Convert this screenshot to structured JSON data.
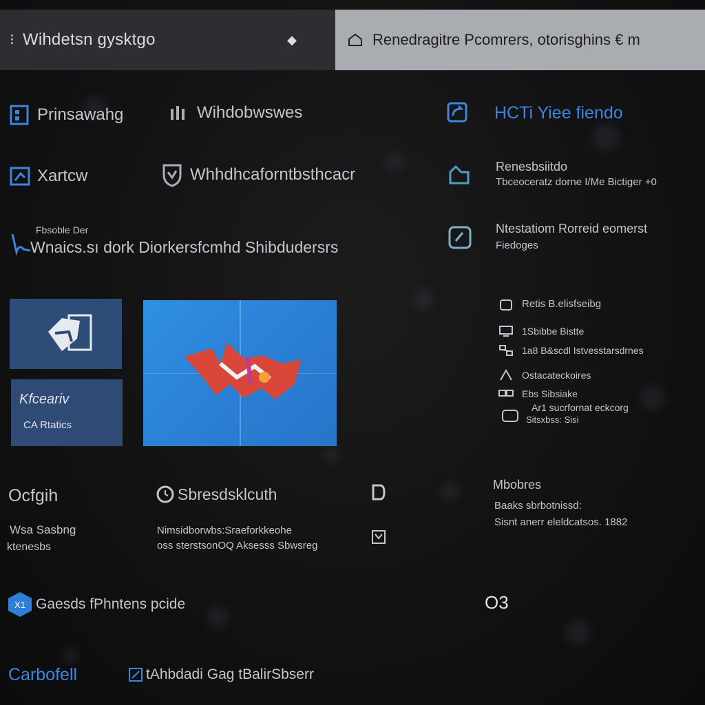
{
  "titlebar": {
    "title": "Wihdetsn gysktgo",
    "search_text": "Renedragitre Pcomrers, otorisghins € m"
  },
  "nav": {
    "item1": "Prinsawahg",
    "item2": "Wihdobwswes",
    "item3": "Xartcw",
    "item4": "Whhdhcaforntbsthcacr",
    "item5_small": "Fbsoble Der",
    "item5": "Wnaics.sı dork Diorkersfcmhd Shibdudersrs"
  },
  "right_panel": {
    "header": "HCTi Yiee fiendo",
    "row1_title": "Renesbsiitdo",
    "row1_sub": "Tbceoceratz dorne I/Me Bictiger +0",
    "row2_title": "Ntestatiom Rorreid eomerst",
    "row2_sub": "Fiedoges",
    "list": [
      "Retis B.elisfseibg",
      "1Sbibbe Bistte",
      "1a8 B&scdl Istvesstarsdrnes",
      "Ostacateckoires",
      "Ebs Sibsiake",
      "Ar1 sucrfornat eckcorg",
      "Sitsxbss: Sisi"
    ]
  },
  "tiles": {
    "tile_b_script": "Kfceariv",
    "tile_b_label": "CA Rtatics"
  },
  "lower": {
    "col1_title": "Ocfgih",
    "col1_line1": "Wsa Sasbng",
    "col1_line2": "ktenesbs",
    "col2_title": "Sbresdsklcuth",
    "col2_line1": "Nimsidborwbs:Sraeforkkeohe",
    "col2_line2": "oss sterstsonOQ Aksesss Sbwsreg",
    "col3_title": "Mbobres",
    "col3_line1": "Baaks sbrbotnissd:",
    "col3_line2": "Sisnt anerr eleldcatsos. 1882",
    "badge": "O3"
  },
  "footer": {
    "blue_item": "Gaesds fPhntens pcide",
    "left": "Carbofell",
    "right": "tAhbdadi Gag tBalirSbserr"
  },
  "colors": {
    "accent_blue": "#3c86e0",
    "tile_dark_blue": "#2e4c78",
    "tile_bright_blue": "#2f8fe0",
    "titlebar_dark": "#2d2e31",
    "titlebar_light": "#a9acb0"
  }
}
